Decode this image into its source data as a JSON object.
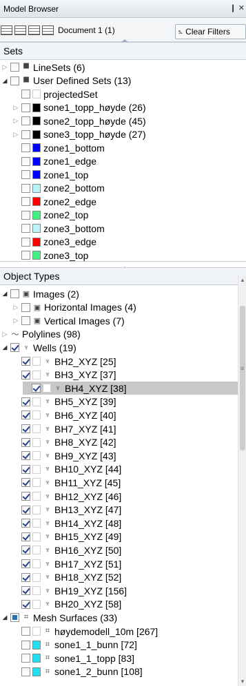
{
  "window": {
    "title": "Model Browser",
    "controls": "Ɇ ×"
  },
  "toolbar": {
    "document": "Document 1 (1)",
    "clear_filters": "Clear Filters"
  },
  "sets": {
    "header": "Sets",
    "rows": [
      {
        "label": "LineSets (6)",
        "exp": "closed",
        "cb": "",
        "icon": "folder",
        "swatch": null,
        "indent": 0
      },
      {
        "label": "User Defined Sets (13)",
        "exp": "open",
        "cb": "",
        "icon": "folder",
        "swatch": null,
        "indent": 0
      },
      {
        "label": "projectedSet",
        "exp": "",
        "cb": "",
        "icon": null,
        "swatch": "#ffffff",
        "indent": 1
      },
      {
        "label": "sone1_topp_høyde (26)",
        "exp": "closed",
        "cb": "",
        "icon": null,
        "swatch": "#000000",
        "indent": 1
      },
      {
        "label": "sone2_topp_høyde (45)",
        "exp": "closed",
        "cb": "",
        "icon": null,
        "swatch": "#000000",
        "indent": 1
      },
      {
        "label": "sone3_topp_høyde (27)",
        "exp": "closed",
        "cb": "",
        "icon": null,
        "swatch": "#000000",
        "indent": 1
      },
      {
        "label": "zone1_bottom",
        "exp": "",
        "cb": "",
        "icon": null,
        "swatch": "#0000ff",
        "indent": 1
      },
      {
        "label": "zone1_edge",
        "exp": "",
        "cb": "",
        "icon": null,
        "swatch": "#0000ff",
        "indent": 1
      },
      {
        "label": "zone1_top",
        "exp": "",
        "cb": "",
        "icon": null,
        "swatch": "#0000ff",
        "indent": 1
      },
      {
        "label": "zone2_bottom",
        "exp": "",
        "cb": "",
        "icon": null,
        "swatch": "#b8f4f8",
        "indent": 1
      },
      {
        "label": "zone2_edge",
        "exp": "",
        "cb": "",
        "icon": null,
        "swatch": "#ff0000",
        "indent": 1
      },
      {
        "label": "zone2_top",
        "exp": "",
        "cb": "",
        "icon": null,
        "swatch": "#40f080",
        "indent": 1
      },
      {
        "label": "zone3_bottom",
        "exp": "",
        "cb": "",
        "icon": null,
        "swatch": "#b8f4f8",
        "indent": 1
      },
      {
        "label": "zone3_edge",
        "exp": "",
        "cb": "",
        "icon": null,
        "swatch": "#ff0000",
        "indent": 1
      },
      {
        "label": "zone3_top",
        "exp": "",
        "cb": "",
        "icon": null,
        "swatch": "#40f080",
        "indent": 1
      }
    ]
  },
  "objects": {
    "header": "Object Types",
    "rows": [
      {
        "label": "Images (2)",
        "exp": "open",
        "cb": "",
        "icon": "image",
        "swatch": null,
        "indent": 0
      },
      {
        "label": "Horizontal Images (4)",
        "exp": "closed",
        "cb": "",
        "icon": "image",
        "swatch": null,
        "indent": 1
      },
      {
        "label": "Vertical Images (7)",
        "exp": "closed",
        "cb": "",
        "icon": "image",
        "swatch": null,
        "indent": 1
      },
      {
        "label": "Polylines (98)",
        "exp": "closed",
        "cb": null,
        "icon": "polyline",
        "swatch": null,
        "indent": 0
      },
      {
        "label": "Wells (19)",
        "exp": "open",
        "cb": "checked",
        "icon": "well",
        "swatch": null,
        "indent": 0
      },
      {
        "label": "BH2_XYZ [25]",
        "exp": "",
        "cb": "checked",
        "icon": "well",
        "swatch": "#ffffff",
        "indent": 1
      },
      {
        "label": "BH3_XYZ [37]",
        "exp": "",
        "cb": "checked",
        "icon": "well",
        "swatch": "#ffffff",
        "indent": 1
      },
      {
        "label": "BH4_XYZ [38]",
        "exp": "",
        "cb": "checked",
        "icon": "well",
        "swatch": "#ffffff",
        "indent": 1,
        "selected": true
      },
      {
        "label": "BH5_XYZ [39]",
        "exp": "",
        "cb": "checked",
        "icon": "well",
        "swatch": "#ffffff",
        "indent": 1
      },
      {
        "label": "BH6_XYZ [40]",
        "exp": "",
        "cb": "checked",
        "icon": "well",
        "swatch": "#ffffff",
        "indent": 1
      },
      {
        "label": "BH7_XYZ [41]",
        "exp": "",
        "cb": "checked",
        "icon": "well",
        "swatch": "#ffffff",
        "indent": 1
      },
      {
        "label": "BH8_XYZ [42]",
        "exp": "",
        "cb": "checked",
        "icon": "well",
        "swatch": "#ffffff",
        "indent": 1
      },
      {
        "label": "BH9_XYZ [43]",
        "exp": "",
        "cb": "checked",
        "icon": "well",
        "swatch": "#ffffff",
        "indent": 1
      },
      {
        "label": "BH10_XYZ [44]",
        "exp": "",
        "cb": "checked",
        "icon": "well",
        "swatch": "#ffffff",
        "indent": 1
      },
      {
        "label": "BH11_XYZ [45]",
        "exp": "",
        "cb": "checked",
        "icon": "well",
        "swatch": "#ffffff",
        "indent": 1
      },
      {
        "label": "BH12_XYZ [46]",
        "exp": "",
        "cb": "checked",
        "icon": "well",
        "swatch": "#ffffff",
        "indent": 1
      },
      {
        "label": "BH13_XYZ [47]",
        "exp": "",
        "cb": "checked",
        "icon": "well",
        "swatch": "#ffffff",
        "indent": 1
      },
      {
        "label": "BH14_XYZ [48]",
        "exp": "",
        "cb": "checked",
        "icon": "well",
        "swatch": "#ffffff",
        "indent": 1
      },
      {
        "label": "BH15_XYZ [49]",
        "exp": "",
        "cb": "checked",
        "icon": "well",
        "swatch": "#ffffff",
        "indent": 1
      },
      {
        "label": "BH16_XYZ [50]",
        "exp": "",
        "cb": "checked",
        "icon": "well",
        "swatch": "#ffffff",
        "indent": 1
      },
      {
        "label": "BH17_XYZ [51]",
        "exp": "",
        "cb": "checked",
        "icon": "well",
        "swatch": "#ffffff",
        "indent": 1
      },
      {
        "label": "BH18_XYZ [52]",
        "exp": "",
        "cb": "checked",
        "icon": "well",
        "swatch": "#ffffff",
        "indent": 1
      },
      {
        "label": "BH19_XYZ [156]",
        "exp": "",
        "cb": "checked",
        "icon": "well",
        "swatch": "#ffffff",
        "indent": 1
      },
      {
        "label": "BH20_XYZ [58]",
        "exp": "",
        "cb": "checked",
        "icon": "well",
        "swatch": "#ffffff",
        "indent": 1
      },
      {
        "label": "Mesh Surfaces (33)",
        "exp": "open",
        "cb": "partial",
        "icon": "mesh",
        "swatch": null,
        "indent": 0
      },
      {
        "label": "høydemodell_10m [267]",
        "exp": "",
        "cb": "",
        "icon": "mesh",
        "swatch": "#ffffff",
        "indent": 1
      },
      {
        "label": "sone1_1_bunn [72]",
        "exp": "",
        "cb": "",
        "icon": "mesh",
        "swatch": "#22e0f0",
        "indent": 1
      },
      {
        "label": "sone1_1_topp [83]",
        "exp": "",
        "cb": "",
        "icon": "mesh",
        "swatch": "#22e0f0",
        "indent": 1
      },
      {
        "label": "sone1_2_bunn [108]",
        "exp": "",
        "cb": "",
        "icon": "mesh",
        "swatch": "#22e0f0",
        "indent": 1
      }
    ]
  },
  "icons": {
    "folder": "⯀",
    "image": "▣",
    "polyline": "〜",
    "well": "♆",
    "mesh": "⌗",
    "filter": "⦩"
  }
}
